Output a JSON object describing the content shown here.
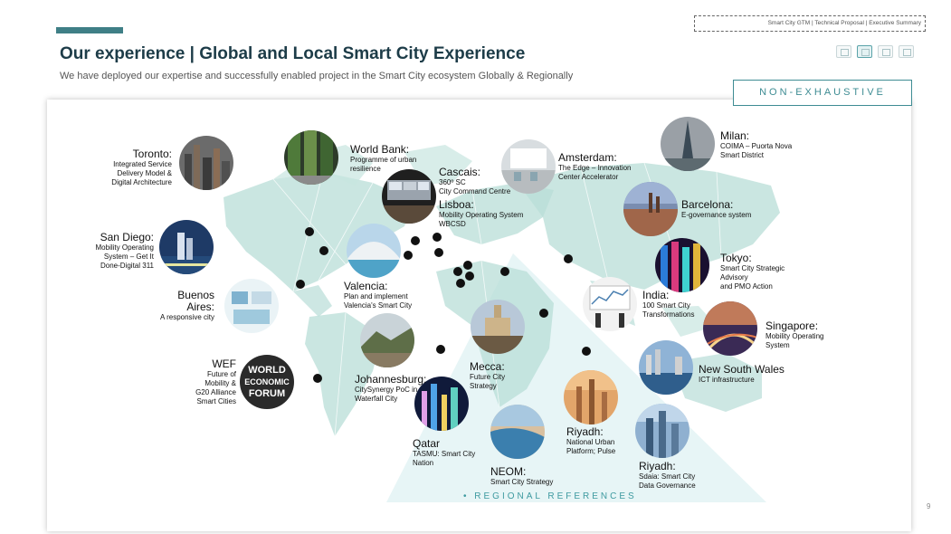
{
  "header": {
    "doc_tag": "Smart City GTM | Technical Proposal | Executive Summary",
    "title": "Our experience | Global and Local Smart City Experience",
    "subtitle": "We have deployed our expertise and successfully enabled project in the Smart City ecosystem Globally & Regionally",
    "toolbar_icons": [
      "image-icon",
      "document-icon",
      "image-icon",
      "person-icon"
    ]
  },
  "badge": "NON-EXHAUSTIVE",
  "regional_label": "•   REGIONAL REFERENCES",
  "page_number": "9",
  "colors": {
    "title": "#1d3c48",
    "accent": "#3f7f86",
    "teal_text": "#3e9aa0",
    "map": "#b8ddd7"
  },
  "references": [
    {
      "id": "toronto",
      "name": "Toronto:",
      "desc": [
        "Integrated Service",
        "Delivery Model &",
        "Digital Architecture"
      ]
    },
    {
      "id": "worldbank",
      "name": "World Bank:",
      "desc": [
        "Programme of urban",
        "resilience"
      ]
    },
    {
      "id": "cascais",
      "name": "Cascais:",
      "desc": [
        "360º SC",
        "City Command Centre"
      ]
    },
    {
      "id": "lisboa",
      "name": "Lisboa:",
      "desc": [
        "Mobility Operating System",
        "WBCSD"
      ]
    },
    {
      "id": "amsterdam",
      "name": "Amsterdam:",
      "desc": [
        "The Edge – Innovation",
        "Center Accelerator"
      ]
    },
    {
      "id": "milan",
      "name": "Milan:",
      "desc": [
        "COIMA – Puorta Nova",
        "Smart District"
      ]
    },
    {
      "id": "barcelona",
      "name": "Barcelona:",
      "desc": [
        "E-governance system"
      ]
    },
    {
      "id": "sandiego",
      "name": "San Diego:",
      "desc": [
        "Mobility Operating",
        "System – Get It",
        "Done-Digital 311"
      ]
    },
    {
      "id": "tokyo",
      "name": "Tokyo:",
      "desc": [
        "Smart City Strategic",
        "Advisory",
        "and PMO Action"
      ]
    },
    {
      "id": "buenosaires",
      "name_lines": [
        "Buenos",
        "Aires:"
      ],
      "desc": [
        "A responsive city"
      ]
    },
    {
      "id": "valencia",
      "name": "Valencia:",
      "desc": [
        "Plan and implement",
        "Valencia's Smart City"
      ]
    },
    {
      "id": "india",
      "name": "India:",
      "desc": [
        "100 Smart City",
        "Transformations"
      ]
    },
    {
      "id": "singapore",
      "name": "Singapore:",
      "desc": [
        "Mobility Operating",
        "System"
      ]
    },
    {
      "id": "wef",
      "name": "WEF",
      "desc": [
        "Future of",
        "Mobility &",
        "G20 Alliance",
        "Smart Cities"
      ]
    },
    {
      "id": "johannesburg",
      "name": "Johannesburg:",
      "desc": [
        "CitySynergy PoC in",
        "Waterfall City"
      ]
    },
    {
      "id": "mecca",
      "name": "Mecca:",
      "desc": [
        "Future City",
        "Strategy"
      ]
    },
    {
      "id": "nsw",
      "name": "New South Wales",
      "desc": [
        "ICT infrastructure"
      ]
    },
    {
      "id": "qatar",
      "name": "Qatar",
      "desc": [
        "TASMU: Smart City",
        "Nation"
      ]
    },
    {
      "id": "riyadh1",
      "name": "Riyadh:",
      "desc": [
        "National Urban",
        "Platform; Pulse"
      ]
    },
    {
      "id": "neom",
      "name": "NEOM:",
      "desc": [
        "Smart City Strategy"
      ]
    },
    {
      "id": "riyadh2",
      "name": "Riyadh:",
      "desc": [
        "Sdaia: Smart City",
        "Data Governance"
      ]
    }
  ],
  "wef_logo_text": [
    "WORLD",
    "ECONOMIC",
    "FORUM"
  ]
}
